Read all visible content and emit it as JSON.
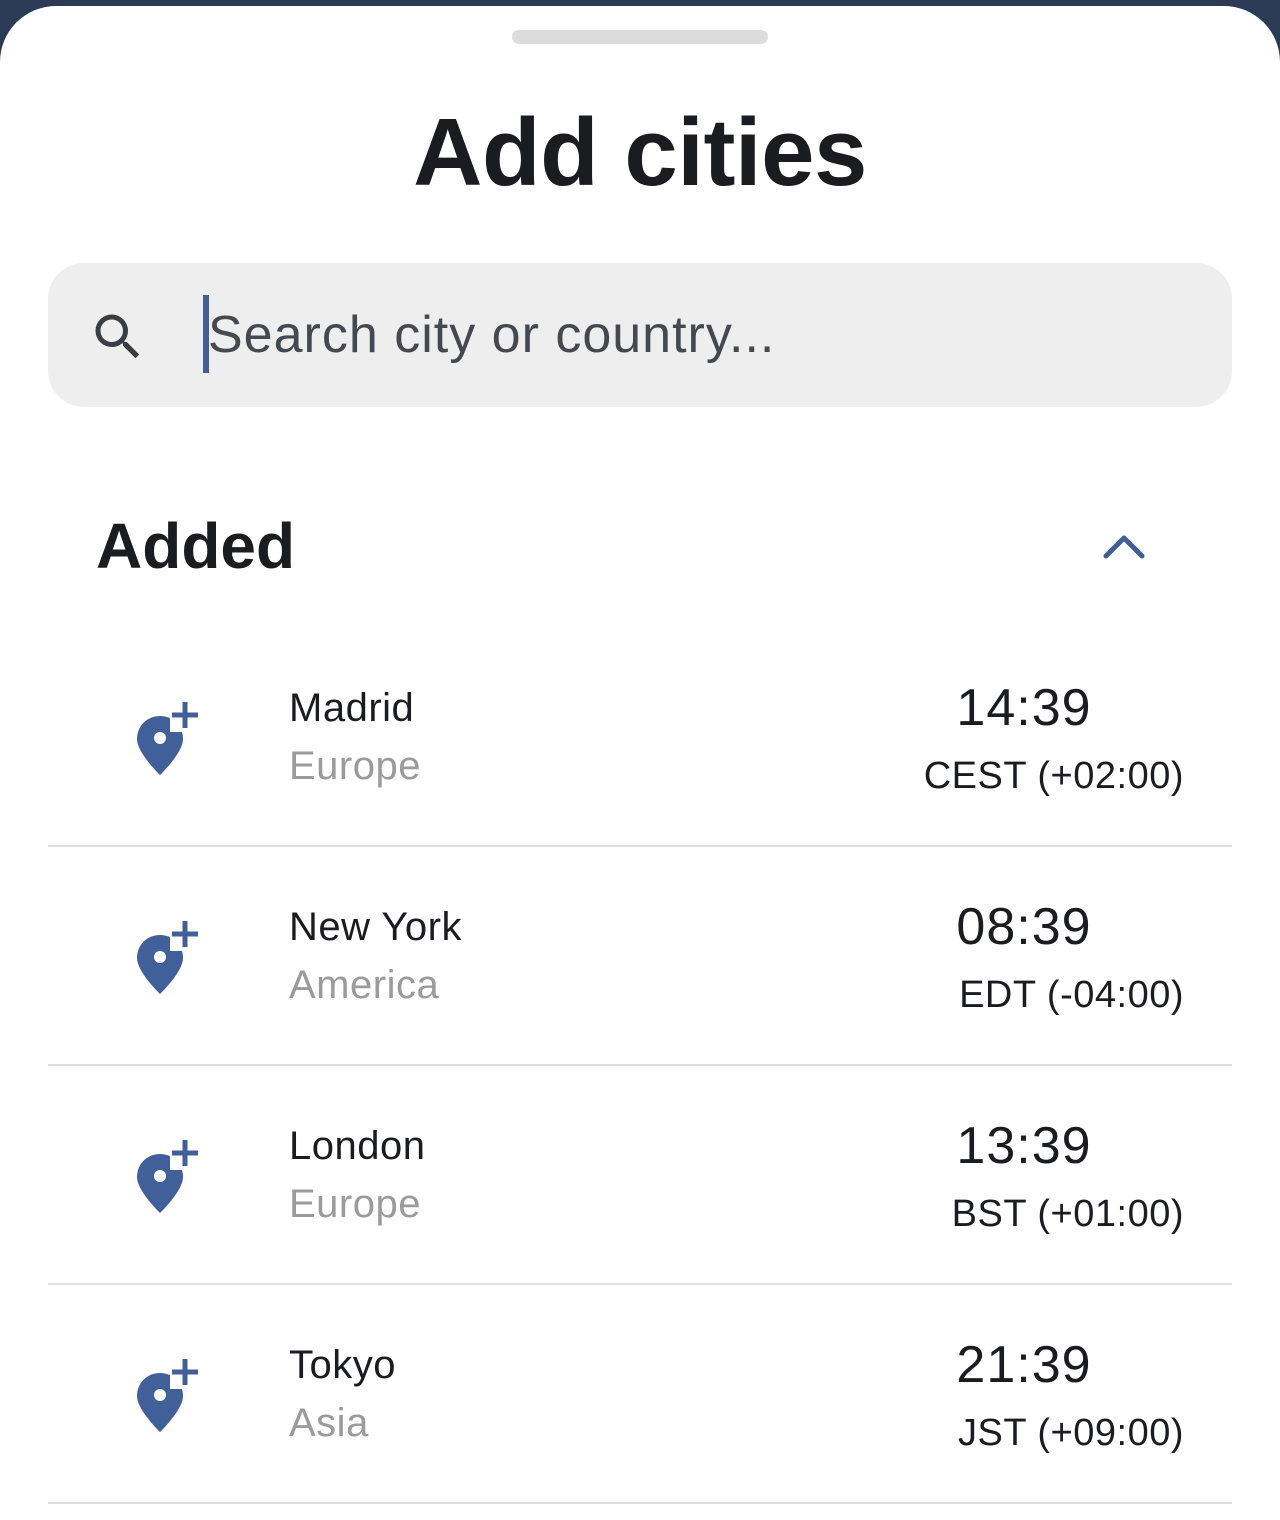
{
  "colors": {
    "accent": "#3f5f95",
    "pin": "#41609a",
    "background": "#ffffff",
    "search_bg": "#eeeeee",
    "divider": "#dedede",
    "secondary_text": "#9b9b9b"
  },
  "sheet": {
    "title": "Add cities"
  },
  "search": {
    "icon": "search-icon",
    "placeholder": "Search city or country...",
    "value": ""
  },
  "added_section": {
    "title": "Added",
    "toggle_icon": "chevron-up-icon",
    "cities": [
      {
        "name": "Madrid",
        "region": "Europe",
        "time": "14:39",
        "zone": "CEST (+02:00)",
        "icon": "add-location-icon"
      },
      {
        "name": "New York",
        "region": "America",
        "time": "08:39",
        "zone": "EDT (-04:00)",
        "icon": "add-location-icon"
      },
      {
        "name": "London",
        "region": "Europe",
        "time": "13:39",
        "zone": "BST (+01:00)",
        "icon": "add-location-icon"
      },
      {
        "name": "Tokyo",
        "region": "Asia",
        "time": "21:39",
        "zone": "JST (+09:00)",
        "icon": "add-location-icon"
      }
    ]
  }
}
